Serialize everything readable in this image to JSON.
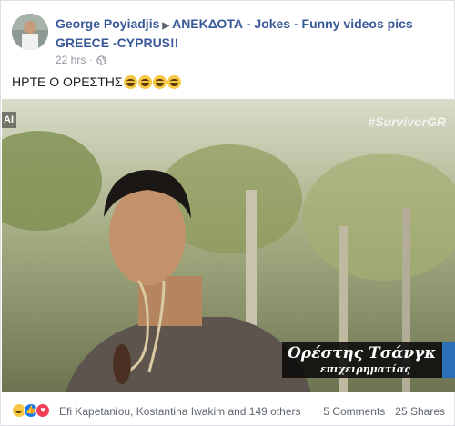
{
  "post": {
    "author": "George Poyiadjis",
    "group": "ΑΝΕΚΔΟΤΑ - Jokes - Funny videos pics GREECE -CYPRUS!!",
    "time": "22 hrs",
    "privacy_icon": "globe-icon",
    "caption": "ΗΡΤΕ Ο ΟΡΕΣΤΗΣ",
    "caption_emojis": [
      "laughing-emoji",
      "laughing-emoji",
      "laughing-emoji",
      "laughing-emoji"
    ]
  },
  "photo": {
    "hashtag": "#SurvivorGR",
    "channel_logo": "ΑΙ",
    "lower_third_name": "Ορέστης Τσάνγκ",
    "lower_third_role": "επιχειρηματίας"
  },
  "footer": {
    "reaction_icons": [
      "haha-icon",
      "like-icon",
      "love-icon"
    ],
    "reactors": "Efi Kapetaniou, Kostantina Iwakim and 149 others",
    "comments": "5 Comments",
    "shares": "25 Shares"
  },
  "colors": {
    "link": "#385898",
    "meta": "#90949c",
    "like": "#1877f2",
    "love": "#f33e58"
  }
}
